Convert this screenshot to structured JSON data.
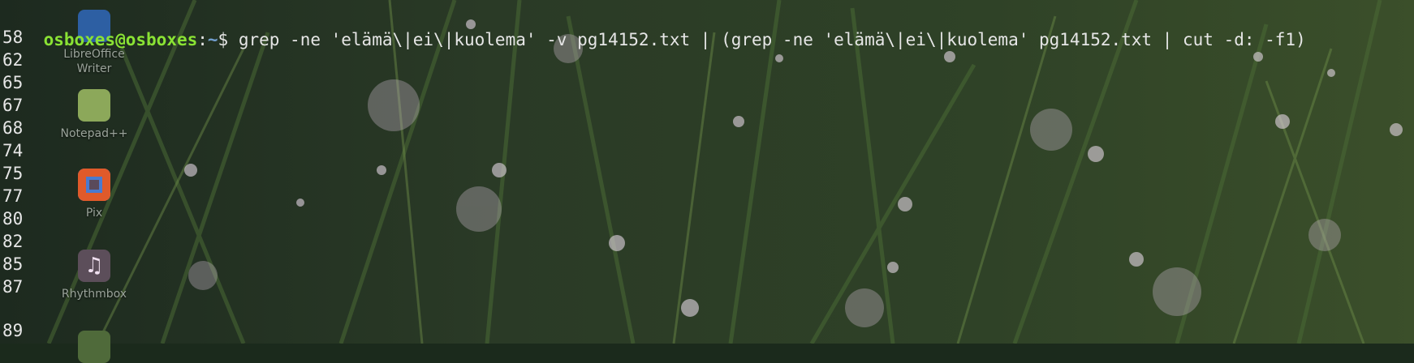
{
  "terminal": {
    "prompt_user": "osboxes@osboxes",
    "prompt_sep": ":",
    "prompt_path": "~",
    "prompt_symbol": "$ ",
    "command": "grep -ne 'elämä\\|ei\\|kuolema' -v pg14152.txt | (grep -ne 'elämä\\|ei\\|kuolema' pg14152.txt | cut -d: -f1)",
    "output_lines": [
      "58",
      "62",
      "65",
      "67",
      "68",
      "74",
      "75",
      "77",
      "80",
      "82",
      "85",
      "87",
      "89"
    ]
  },
  "desktop": {
    "icons": [
      {
        "name": "libreoffice-writer-icon",
        "label_lines": [
          "LibreOffice",
          "Writer"
        ]
      },
      {
        "name": "notepadplusplus-icon",
        "label_lines": [
          "Notepad++"
        ]
      },
      {
        "name": "pix-icon",
        "label_lines": [
          "Pix"
        ]
      },
      {
        "name": "rhythmbox-icon",
        "label_lines": [
          "Rhythmbox"
        ]
      },
      {
        "name": "partial-app-icon",
        "label_lines": []
      }
    ]
  },
  "colors": {
    "prompt_user": "#8ae234",
    "prompt_path": "#729fcf",
    "text": "#e6e6e6"
  }
}
